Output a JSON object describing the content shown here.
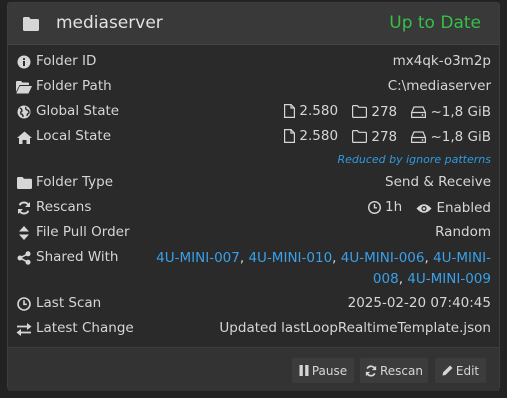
{
  "header": {
    "title": "mediaserver",
    "status": "Up to Date",
    "status_color": "#35c049"
  },
  "rows": {
    "folder_id": {
      "label": "Folder ID",
      "value": "mx4qk-o3m2p",
      "icon": "info-circle-icon"
    },
    "folder_path": {
      "label": "Folder Path",
      "value": "C:\\mediaserver",
      "icon": "folder-open-icon"
    },
    "global_state": {
      "label": "Global State",
      "files": "2.580",
      "dirs": "278",
      "size": "~1,8 GiB",
      "icon": "globe-icon"
    },
    "local_state": {
      "label": "Local State",
      "files": "2.580",
      "dirs": "278",
      "size": "~1,8 GiB",
      "icon": "home-icon",
      "note": "Reduced by ignore patterns"
    },
    "folder_type": {
      "label": "Folder Type",
      "value": "Send & Receive",
      "icon": "folder-icon"
    },
    "rescans": {
      "label": "Rescans",
      "interval": "1h",
      "watch": "Enabled",
      "icon": "refresh-icon"
    },
    "file_pull_order": {
      "label": "File Pull Order",
      "value": "Random",
      "icon": "sort-icon"
    },
    "shared_with": {
      "label": "Shared With",
      "devices": [
        "4U-MINI-007",
        "4U-MINI-010",
        "4U-MINI-006",
        "4U-MINI-008",
        "4U-MINI-009"
      ],
      "icon": "share-icon"
    },
    "last_scan": {
      "label": "Last Scan",
      "value": "2025-02-20 07:40:45",
      "icon": "clock-icon"
    },
    "latest_change": {
      "label": "Latest Change",
      "value": "Updated lastLoopRealtimeTemplate.json",
      "icon": "exchange-icon"
    }
  },
  "buttons": {
    "pause": "Pause",
    "rescan": "Rescan",
    "edit": "Edit"
  }
}
